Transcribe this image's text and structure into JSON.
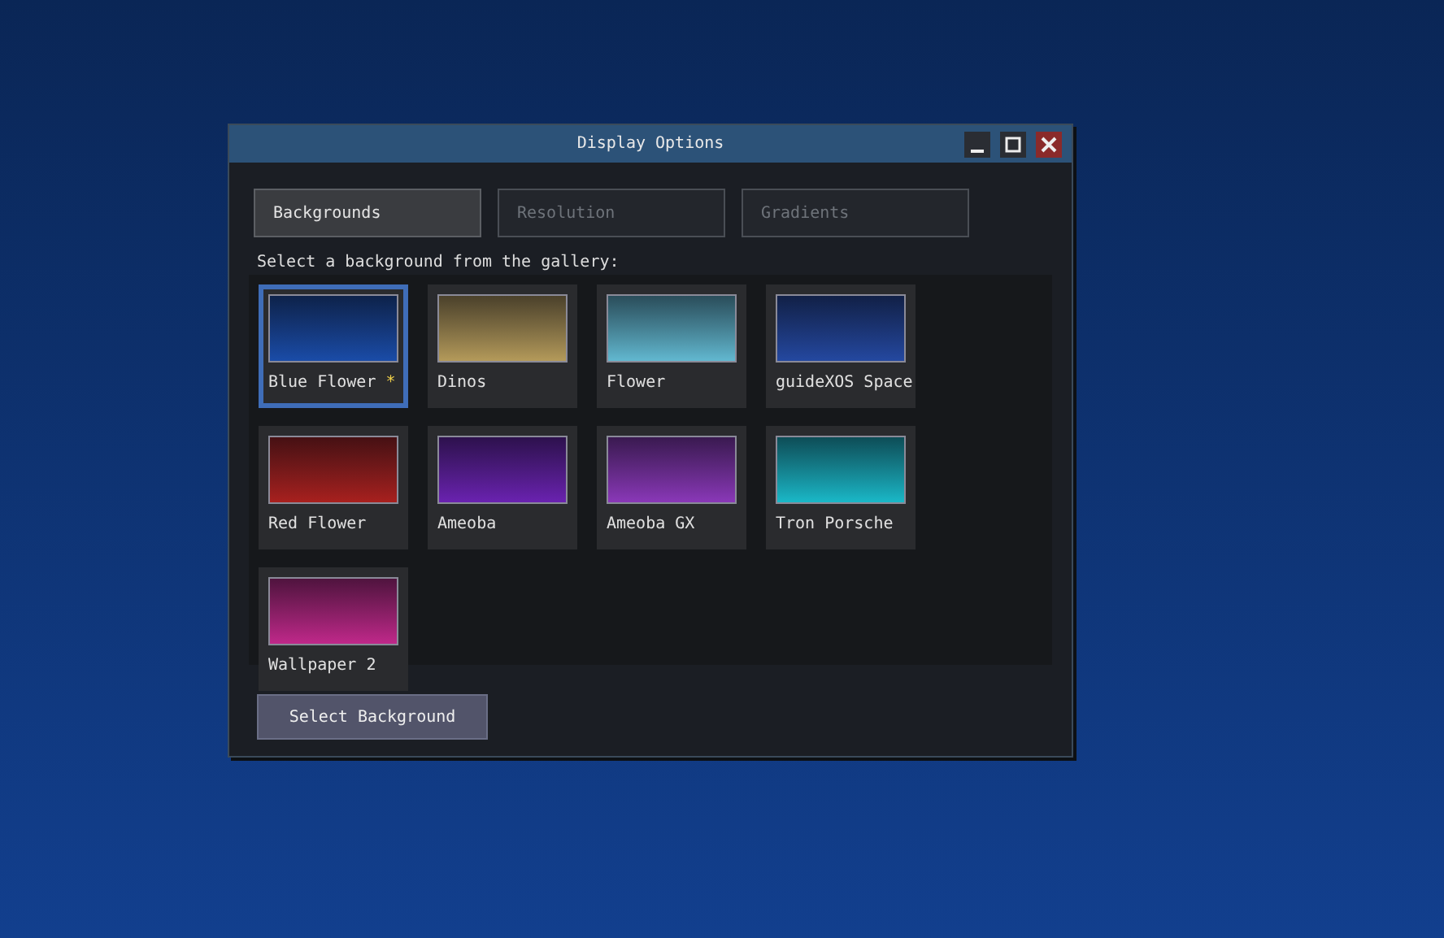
{
  "window": {
    "title": "Display Options"
  },
  "tabs": [
    {
      "label": "Backgrounds",
      "selected": true
    },
    {
      "label": "Resolution",
      "selected": false
    },
    {
      "label": "Gradients",
      "selected": false
    }
  ],
  "instruction": "Select a background from the gallery:",
  "gallery": [
    {
      "name": "Blue Flower",
      "badge": "*",
      "selected": true,
      "color": "#1a4ca8"
    },
    {
      "name": "Dinos",
      "selected": false,
      "color": "#b49a5a"
    },
    {
      "name": "Flower",
      "selected": false,
      "color": "#62b8d0"
    },
    {
      "name": "guideXOS Space",
      "selected": false,
      "color": "#2448a0"
    },
    {
      "name": "Red Flower",
      "selected": false,
      "color": "#a8201e"
    },
    {
      "name": "Ameoba",
      "selected": false,
      "color": "#6a22b0"
    },
    {
      "name": "Ameoba GX",
      "selected": false,
      "color": "#8a38b8"
    },
    {
      "name": "Tron Porsche",
      "selected": false,
      "color": "#1ab8c8"
    },
    {
      "name": "Wallpaper 2",
      "selected": false,
      "color": "#c0288a"
    }
  ],
  "button": "Select Background"
}
